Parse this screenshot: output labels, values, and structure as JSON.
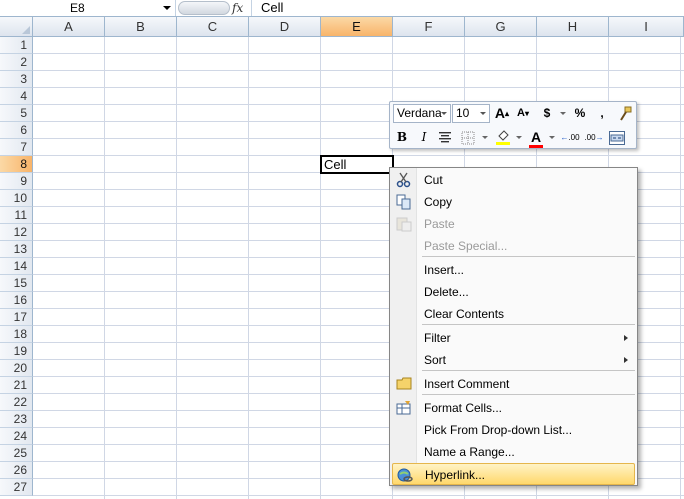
{
  "formula_bar": {
    "name_box": "E8",
    "fx_label": "fx",
    "content": "Cell"
  },
  "grid": {
    "columns": [
      "A",
      "B",
      "C",
      "D",
      "E",
      "F",
      "G",
      "H",
      "I"
    ],
    "rows": [
      "1",
      "2",
      "3",
      "4",
      "5",
      "6",
      "7",
      "8",
      "9",
      "10",
      "11",
      "12",
      "13",
      "14",
      "15",
      "16",
      "17",
      "18",
      "19",
      "20",
      "21",
      "22",
      "23",
      "24",
      "25",
      "26",
      "27"
    ],
    "selected_column": "E",
    "selected_row": "8",
    "active_cell_value": "Cell"
  },
  "mini_toolbar": {
    "font_name": "Verdana",
    "font_size": "10",
    "grow_font": "A",
    "shrink_font": "A",
    "currency": "$",
    "percent": "%",
    "comma": ",",
    "bold": "B",
    "italic": "I",
    "font_color_label": "A",
    "increase_decimal": ".00",
    "decrease_decimal": ".00",
    "fill_color": "#ffff00",
    "font_color": "#ff0000"
  },
  "context_menu": {
    "items": [
      {
        "label": "Cut",
        "icon": "scissors-icon",
        "enabled": true
      },
      {
        "label": "Copy",
        "icon": "copy-icon",
        "enabled": true
      },
      {
        "label": "Paste",
        "icon": "paste-icon",
        "enabled": false
      },
      {
        "label": "Paste Special...",
        "icon": "",
        "enabled": false
      },
      {
        "label": "Insert...",
        "icon": "",
        "enabled": true
      },
      {
        "label": "Delete...",
        "icon": "",
        "enabled": true
      },
      {
        "label": "Clear Contents",
        "icon": "",
        "enabled": true
      },
      {
        "label": "Filter",
        "icon": "",
        "enabled": true,
        "submenu": true
      },
      {
        "label": "Sort",
        "icon": "",
        "enabled": true,
        "submenu": true
      },
      {
        "label": "Insert Comment",
        "icon": "comment-icon",
        "enabled": true
      },
      {
        "label": "Format Cells...",
        "icon": "format-cells-icon",
        "enabled": true
      },
      {
        "label": "Pick From Drop-down List...",
        "icon": "",
        "enabled": true
      },
      {
        "label": "Name a Range...",
        "icon": "",
        "enabled": true
      },
      {
        "label": "Hyperlink...",
        "icon": "hyperlink-icon",
        "enabled": true,
        "highlighted": true
      }
    ]
  }
}
